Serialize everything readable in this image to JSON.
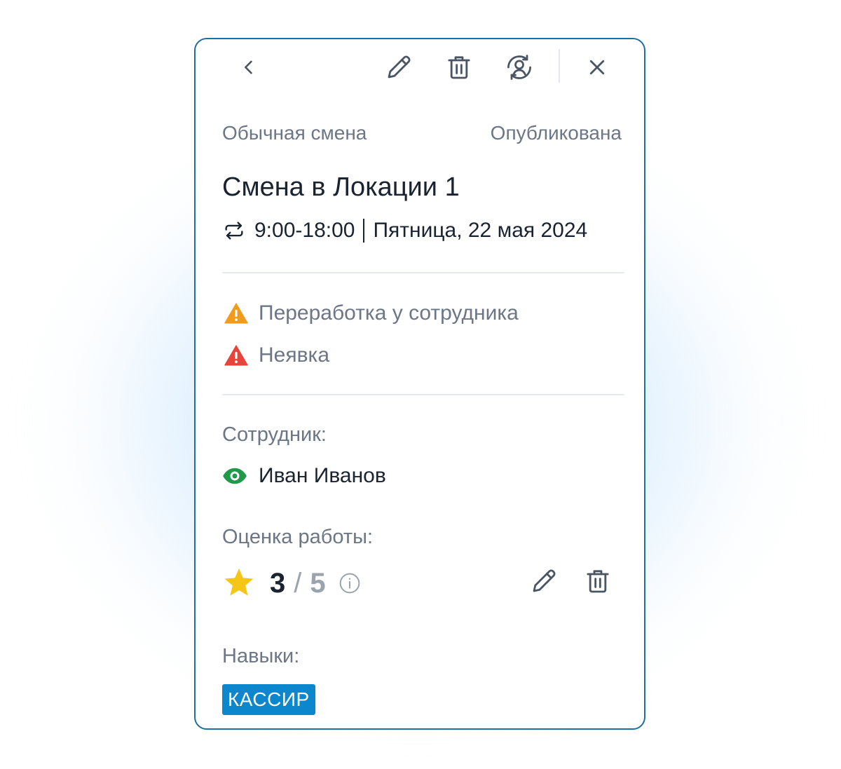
{
  "toolbar": {
    "back_icon": "chevron-left-icon",
    "edit_icon": "pencil-icon",
    "delete_icon": "trash-icon",
    "reassign_icon": "user-sync-icon",
    "close_icon": "close-icon"
  },
  "shift": {
    "type": "Обычная смена",
    "status": "Опубликована",
    "title": "Смена в Локации 1",
    "time": "9:00-18:00",
    "date": "Пятница, 22 мая 2024"
  },
  "alerts": [
    {
      "label": "Переработка у сотрудника",
      "color": "#f29a1a",
      "icon": "warning-icon"
    },
    {
      "label": "Неявка",
      "color": "#e5453a",
      "icon": "warning-icon"
    }
  ],
  "employee": {
    "label": "Сотрудник:",
    "name": "Иван Иванов",
    "icon_color": "#1f9a4a"
  },
  "rating": {
    "label": "Оценка работы:",
    "value": "3",
    "separator": "/",
    "max": "5",
    "star_color": "#f5c518"
  },
  "skills": {
    "label": "Навыки:",
    "items": [
      "КАССИР"
    ],
    "badge_color": "#0c86cc"
  },
  "colors": {
    "border": "#1f6f9e",
    "text_primary": "#1a2330",
    "text_muted": "#6b7686"
  }
}
